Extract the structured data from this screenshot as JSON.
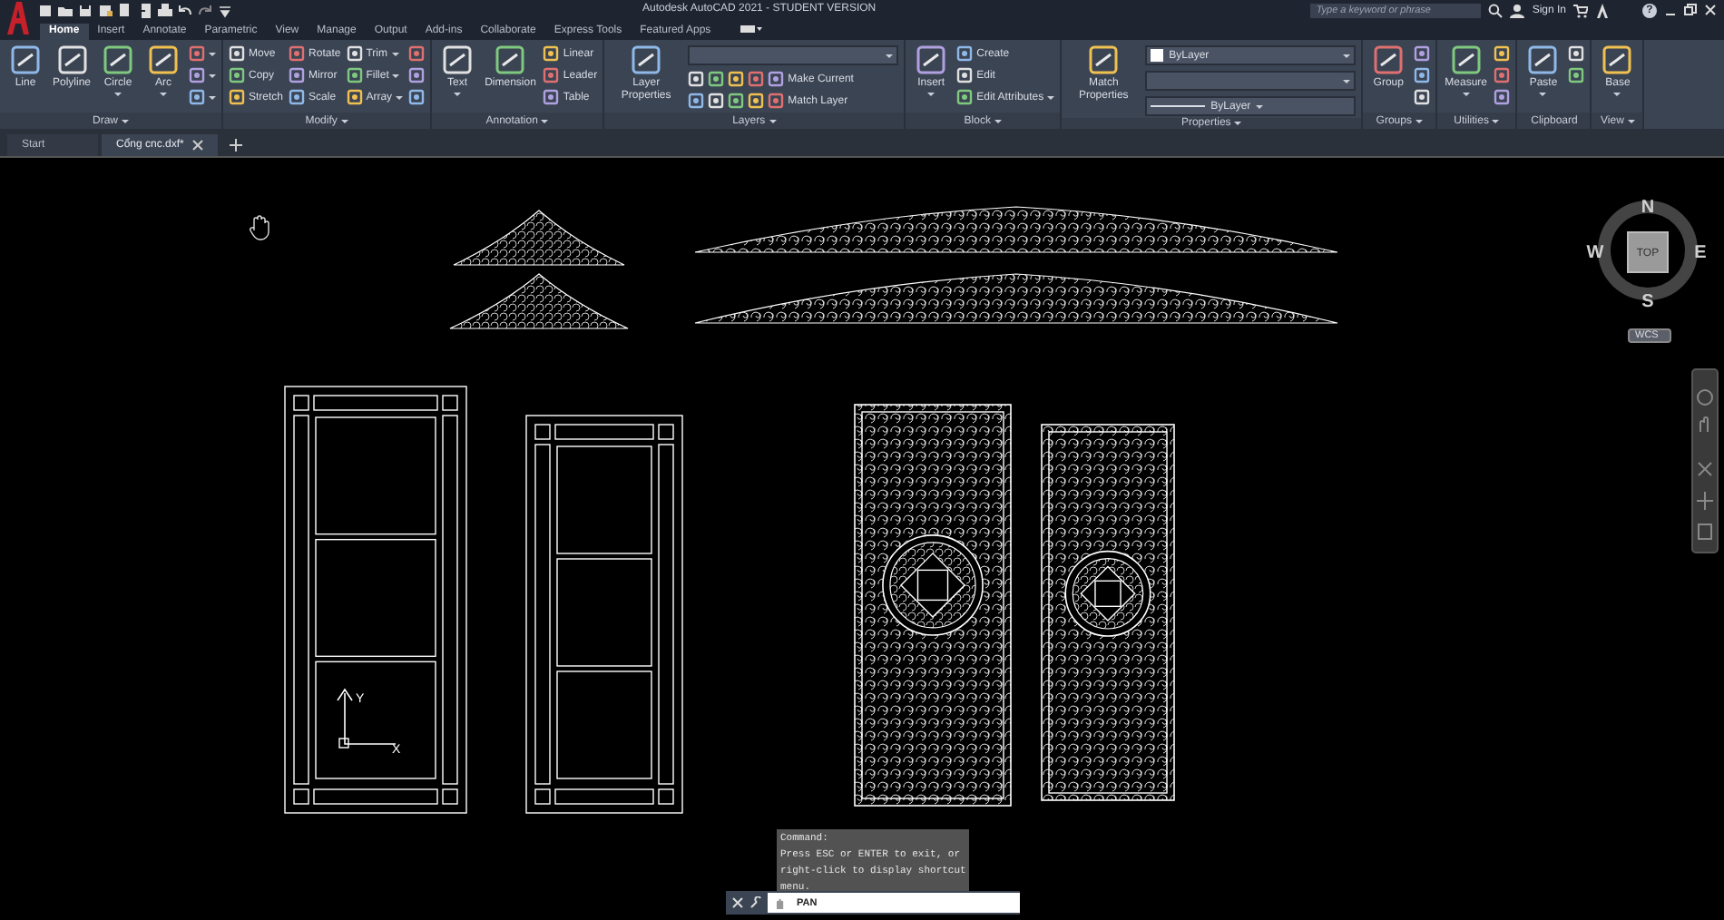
{
  "title_bar": {
    "title": "Autodesk AutoCAD 2021 - STUDENT VERSION",
    "search": {
      "placeholder": "Type a keyword or phrase"
    },
    "sign_in": "Sign In",
    "help": "?"
  },
  "ribbon_tabs": [
    {
      "label": "Home",
      "selected": true
    },
    {
      "label": "Insert",
      "selected": false
    },
    {
      "label": "Annotate",
      "selected": false
    },
    {
      "label": "Parametric",
      "selected": false
    },
    {
      "label": "View",
      "selected": false
    },
    {
      "label": "Manage",
      "selected": false
    },
    {
      "label": "Output",
      "selected": false
    },
    {
      "label": "Add-ins",
      "selected": false
    },
    {
      "label": "Collaborate",
      "selected": false
    },
    {
      "label": "Express Tools",
      "selected": false
    },
    {
      "label": "Featured Apps",
      "selected": false
    }
  ],
  "panels": [
    {
      "title": "Draw",
      "title_dropdown": true,
      "columns": [
        {
          "kind": "large",
          "label": "Line"
        },
        {
          "kind": "large",
          "label": "Polyline"
        },
        {
          "kind": "large",
          "label": "Circle",
          "dropdown": true
        },
        {
          "kind": "large",
          "label": "Arc",
          "dropdown": true
        },
        {
          "kind": "stack",
          "items": [
            {
              "kind": "tool",
              "dropdown": true
            },
            {
              "kind": "tool",
              "dropdown": true
            },
            {
              "kind": "tool",
              "dropdown": true
            }
          ]
        }
      ]
    },
    {
      "title": "Modify",
      "title_dropdown": true,
      "columns": [
        {
          "kind": "stack",
          "items": [
            {
              "kind": "tool",
              "label": "Move"
            },
            {
              "kind": "tool",
              "label": "Copy"
            },
            {
              "kind": "tool",
              "label": "Stretch"
            }
          ]
        },
        {
          "kind": "stack",
          "items": [
            {
              "kind": "tool",
              "label": "Rotate"
            },
            {
              "kind": "tool",
              "label": "Mirror"
            },
            {
              "kind": "tool",
              "label": "Scale"
            }
          ]
        },
        {
          "kind": "stack",
          "items": [
            {
              "kind": "tool",
              "label": "Trim",
              "dropdown": true
            },
            {
              "kind": "tool",
              "label": "Fillet",
              "dropdown": true
            },
            {
              "kind": "tool",
              "label": "Array",
              "dropdown": true
            }
          ]
        },
        {
          "kind": "stack",
          "items": [
            {
              "kind": "tool"
            },
            {
              "kind": "tool"
            },
            {
              "kind": "tool"
            }
          ]
        }
      ]
    },
    {
      "title": "Annotation",
      "title_dropdown": true,
      "columns": [
        {
          "kind": "large",
          "label": "Text",
          "dropdown": true
        },
        {
          "kind": "large",
          "label": "Dimension"
        },
        {
          "kind": "stack",
          "items": [
            {
              "kind": "tool",
              "label": "Linear"
            },
            {
              "kind": "tool",
              "label": "Leader"
            },
            {
              "kind": "tool",
              "label": "Table"
            }
          ]
        }
      ]
    },
    {
      "title": "Layers",
      "title_dropdown": true,
      "columns": [
        {
          "kind": "large",
          "label": "Layer Properties"
        },
        {
          "kind": "stack",
          "items": [
            {
              "kind": "combo"
            },
            {
              "kind": "tool",
              "label": "Make Current",
              "icon_row": true
            },
            {
              "kind": "tool",
              "label": "Match Layer",
              "icon_row": true
            }
          ]
        }
      ]
    },
    {
      "title": "Block",
      "title_dropdown": true,
      "columns": [
        {
          "kind": "large",
          "label": "Insert",
          "dropdown": true
        },
        {
          "kind": "stack",
          "items": [
            {
              "kind": "tool",
              "label": "Create"
            },
            {
              "kind": "tool",
              "label": "Edit"
            },
            {
              "kind": "tool",
              "label": "Edit Attributes",
              "dropdown": true
            }
          ]
        }
      ]
    },
    {
      "title": "Properties",
      "title_dropdown": true,
      "columns": [
        {
          "kind": "large",
          "label": "Match Properties"
        },
        {
          "kind": "stack",
          "items": [
            {
              "kind": "combo",
              "value": "ByLayer",
              "swatch": true
            },
            {
              "kind": "combo"
            },
            {
              "kind": "combo",
              "value": "ByLayer",
              "line": true
            }
          ]
        }
      ]
    },
    {
      "title": "Groups",
      "title_dropdown": true,
      "columns": [
        {
          "kind": "large",
          "label": "Group"
        },
        {
          "kind": "stack",
          "items": [
            {
              "kind": "tool"
            },
            {
              "kind": "tool"
            },
            {
              "kind": "tool"
            }
          ]
        }
      ]
    },
    {
      "title": "Utilities",
      "title_dropdown": true,
      "columns": [
        {
          "kind": "large",
          "label": "Measure",
          "dropdown": true
        },
        {
          "kind": "stack",
          "items": [
            {
              "kind": "tool"
            },
            {
              "kind": "tool"
            },
            {
              "kind": "tool"
            }
          ]
        }
      ]
    },
    {
      "title": "Clipboard",
      "title_dropdown": false,
      "columns": [
        {
          "kind": "large",
          "label": "Paste",
          "dropdown": true
        },
        {
          "kind": "stack",
          "items": [
            {
              "kind": "tool"
            },
            {
              "kind": "tool"
            }
          ]
        }
      ]
    },
    {
      "title": "View",
      "title_dropdown": true,
      "columns": [
        {
          "kind": "large",
          "label": "Base",
          "dropdown": true
        }
      ]
    }
  ],
  "file_tabs": [
    {
      "label": "Start",
      "selected": false,
      "closable": false
    },
    {
      "label": "Cổng cnc.dxf*",
      "selected": true,
      "closable": true
    }
  ],
  "canvas": {
    "ucs": {
      "x_label": "X",
      "y_label": "Y"
    },
    "viewcube": {
      "north": "N",
      "east": "E",
      "south": "S",
      "west": "W",
      "face": "TOP",
      "coordinate_system": "WCS"
    }
  },
  "command_line": {
    "history": [
      "Command:",
      "Press ESC or ENTER to exit, or",
      "right-click to display shortcut",
      "menu."
    ],
    "input": "PAN"
  }
}
